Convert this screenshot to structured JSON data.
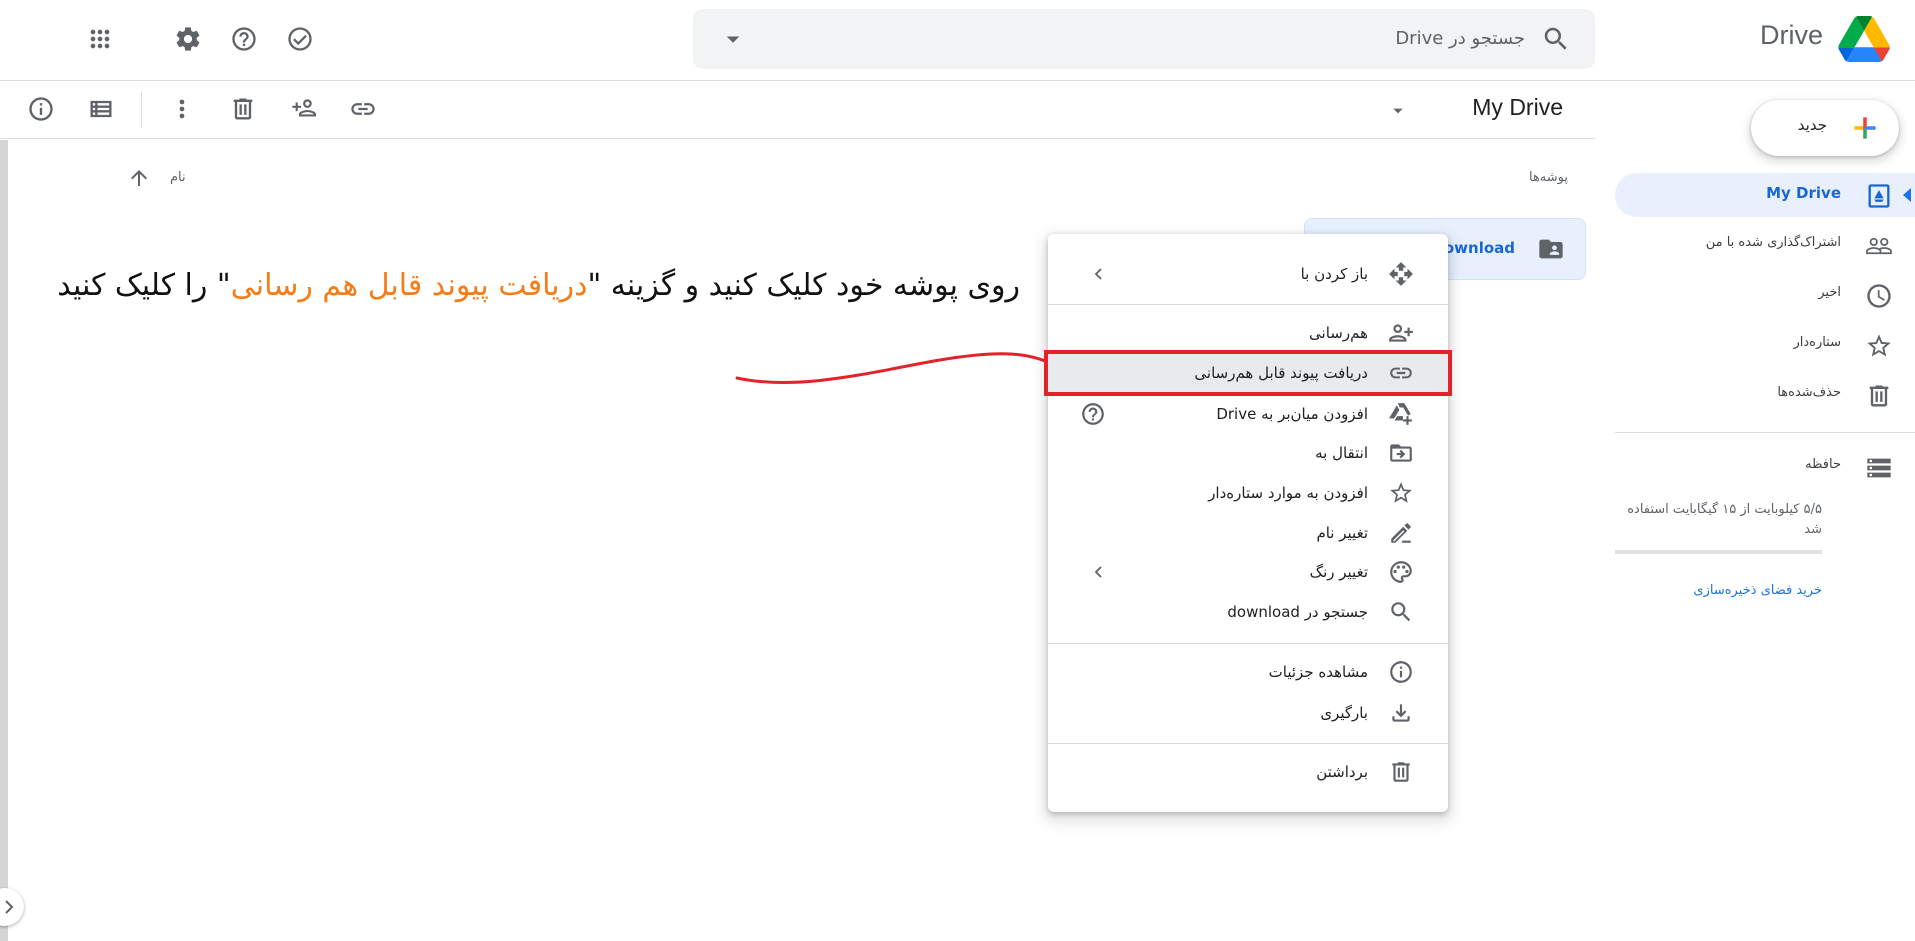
{
  "header": {
    "brand": "Drive",
    "search_placeholder": "جستجو در Drive"
  },
  "toolbar": {
    "title": "My Drive"
  },
  "sidebar": {
    "new_label": "جدید",
    "items": [
      {
        "label": "My Drive",
        "icon": "drive-icon",
        "active": true
      },
      {
        "label": "اشتراک‌گذاری شده با من",
        "icon": "people-icon"
      },
      {
        "label": "اخیر",
        "icon": "clock-icon"
      },
      {
        "label": "ستاره‌دار",
        "icon": "star-icon"
      },
      {
        "label": "حذف‌شده‌ها",
        "icon": "trash-icon"
      },
      {
        "label": "حافظه",
        "icon": "storage-icon"
      }
    ],
    "storage_text": "۵/۵ کیلوبایت از ۱۵ گیگابایت استفاده شد",
    "storage_used_fraction": 0.0,
    "buy_storage": "خرید فضای ذخیره‌سازی"
  },
  "content": {
    "folders_heading": "پوشه‌ها",
    "sort_label": "نام",
    "folder": {
      "name": "download"
    }
  },
  "annotation": {
    "part1": "روی پوشه خود کلیک کنید و گزینه \"",
    "highlight": "دریافت پیوند قابل هم رسانی",
    "part2": "\" را کلیک کنید",
    "highlight_color": "#f57c17",
    "curve_color": "#e3232a"
  },
  "context_menu": {
    "items": [
      {
        "label": "باز کردن با",
        "icon": "open-with-icon",
        "submenu": true
      },
      {
        "label": "هم‌رسانی",
        "icon": "share-icon"
      },
      {
        "label": "دریافت پیوند قابل هم‌رسانی",
        "icon": "link-icon",
        "highlighted": true
      },
      {
        "label": "افزودن میان‌بر به Drive",
        "icon": "add-shortcut-icon",
        "help": true
      },
      {
        "label": "انتقال به",
        "icon": "move-icon"
      },
      {
        "label": "افزودن به موارد ستاره‌دار",
        "icon": "star-icon"
      },
      {
        "label": "تغییر نام",
        "icon": "rename-icon"
      },
      {
        "label": "تغییر رنگ",
        "icon": "palette-icon",
        "submenu": true
      },
      {
        "label": "جستجو در download",
        "icon": "search-icon"
      },
      {
        "label": "مشاهده جزئیات",
        "icon": "info-icon"
      },
      {
        "label": "بارگیری",
        "icon": "download-icon"
      },
      {
        "label": "برداشتن",
        "icon": "trash-icon"
      }
    ]
  }
}
